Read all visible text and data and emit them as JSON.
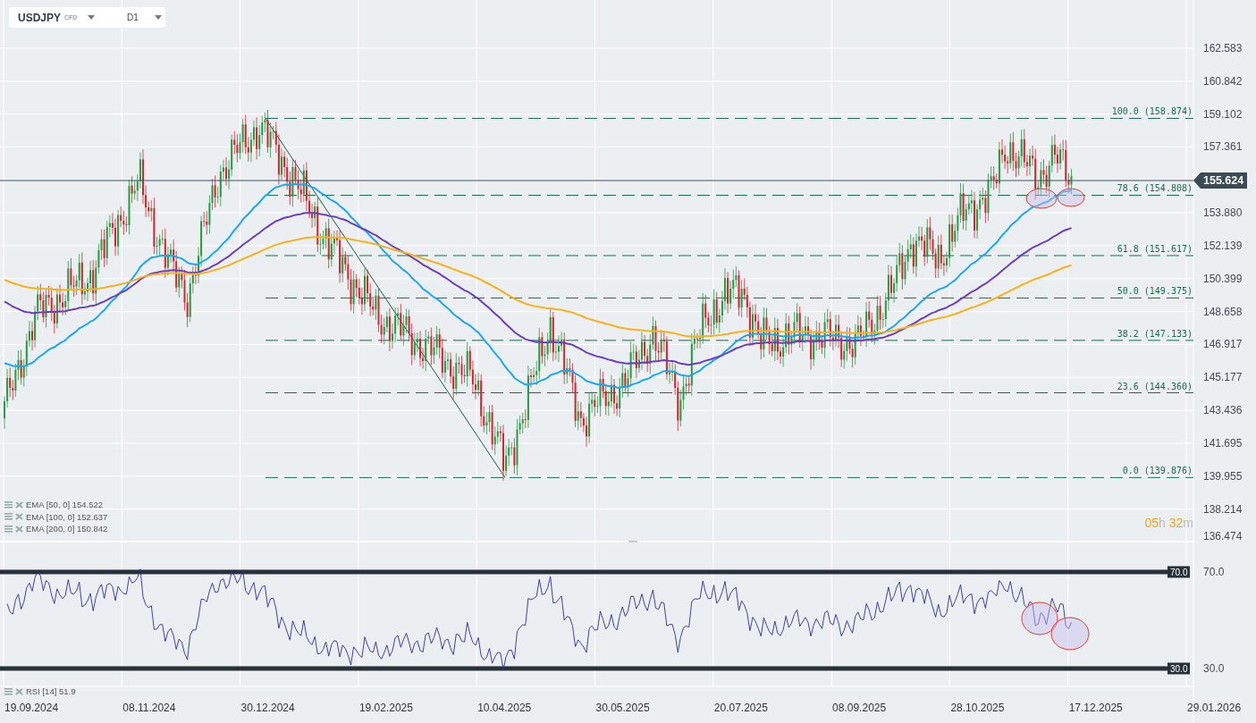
{
  "symbol": {
    "name": "USDJPY",
    "tag": "CFD"
  },
  "timeframe": "D1",
  "price_axis": [
    "162.583",
    "160.842",
    "159.102",
    "157.361",
    "153.880",
    "152.139",
    "150.399",
    "148.658",
    "146.917",
    "145.177",
    "143.436",
    "141.695",
    "139.955",
    "138.214",
    "136.474"
  ],
  "current_price": "155.624",
  "fibonacci": [
    {
      "label": "100.0 (158.874)"
    },
    {
      "label": "78.6 (154.808)"
    },
    {
      "label": "61.8 (151.617)"
    },
    {
      "label": "50.0 (149.375)"
    },
    {
      "label": "38.2 (147.133)"
    },
    {
      "label": "23.6 (144.360)"
    },
    {
      "label": "0.0 (139.876)"
    }
  ],
  "indicators": [
    {
      "label": "EMA [50, 0] 154.522",
      "color": "#1ea7f0"
    },
    {
      "label": "EMA [100, 0] 152.637",
      "color": "#6a3fbf"
    },
    {
      "label": "EMA [200, 0] 150.842",
      "color": "#f5b21b"
    }
  ],
  "countdown": {
    "hours": "05",
    "hours_unit": "h",
    "minutes": "32",
    "minutes_unit": "m"
  },
  "rsi": {
    "legend": "RSI [14] 51.9",
    "levels": [
      {
        "badge": "70.0",
        "axis": "70.0"
      },
      {
        "badge": "30.0",
        "axis": "30.0"
      }
    ]
  },
  "time_axis": [
    "19.09.2024",
    "08.11.2024",
    "30.12.2024",
    "19.02.2025",
    "10.04.2025",
    "30.05.2025",
    "20.07.2025",
    "08.09.2025",
    "28.10.2025",
    "17.12.2025",
    "29.01.2026"
  ]
}
